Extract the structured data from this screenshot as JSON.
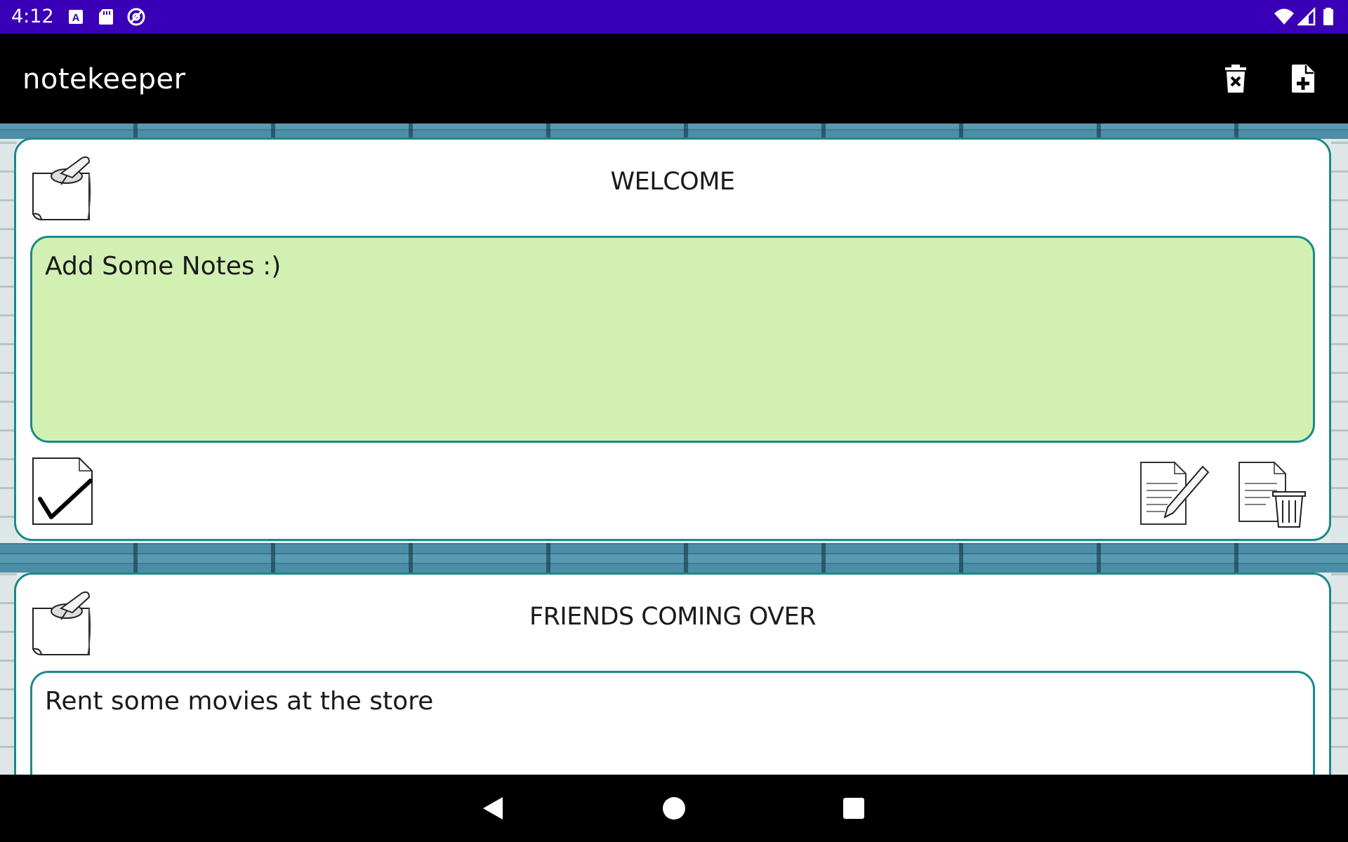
{
  "status_bar": {
    "time": "4:12",
    "left_icons": [
      "a-box-icon",
      "sd-card-icon",
      "at-icon"
    ],
    "right_icons": [
      "wifi-icon",
      "signal-icon",
      "battery-icon"
    ],
    "color": "#3a00b8"
  },
  "app_bar": {
    "title": "notekeeper",
    "actions": [
      "delete-all-icon",
      "new-note-icon"
    ]
  },
  "notes": [
    {
      "title": "WELCOME",
      "body": "Add Some Notes :)",
      "body_color": "#d3f0b3",
      "completed": true
    },
    {
      "title": "FRIENDS COMING OVER",
      "body": "Rent some movies at the store",
      "body_color": "#ffffff"
    }
  ],
  "nav_bar": {
    "buttons": [
      "back-icon",
      "home-icon",
      "recents-icon"
    ]
  },
  "colors": {
    "accent": "#1a8a8a",
    "brick": "#4b8ea6"
  }
}
